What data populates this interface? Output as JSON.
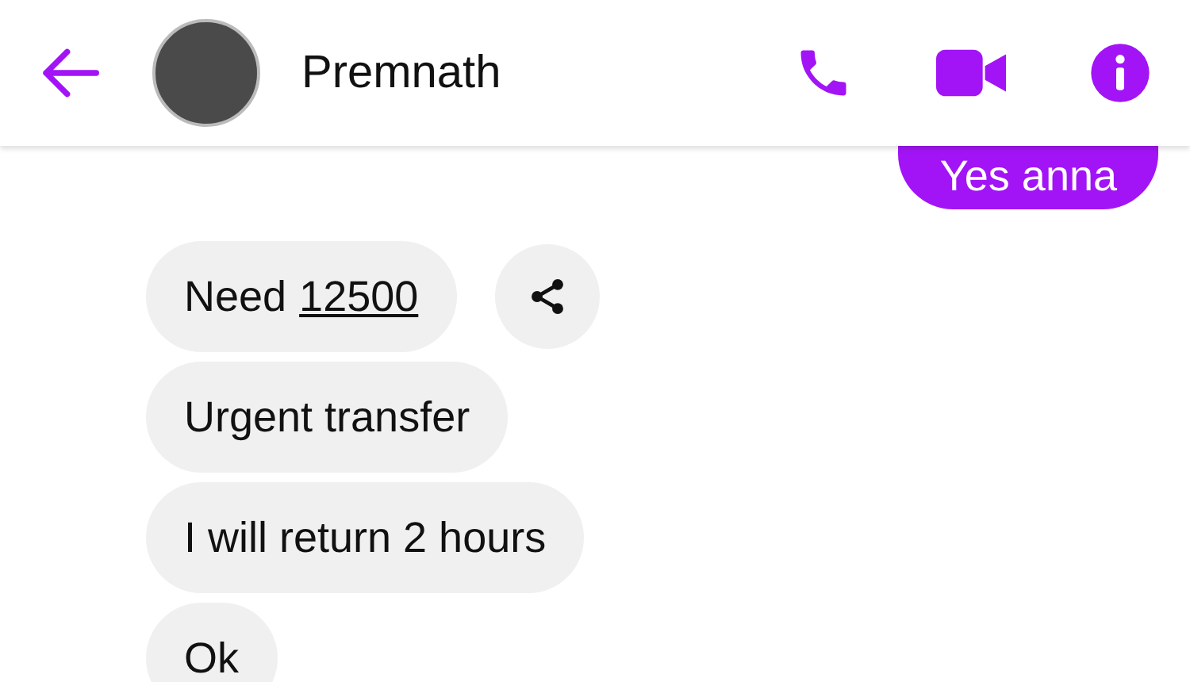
{
  "header": {
    "contact_name": "Premnath"
  },
  "messages": [
    {
      "kind": "sent",
      "text": "Yes anna"
    },
    {
      "kind": "received",
      "text": "Need",
      "link": "12500",
      "shareable": true
    },
    {
      "kind": "received",
      "text": "Urgent transfer"
    },
    {
      "kind": "received",
      "text": "I will return 2 hours"
    },
    {
      "kind": "received",
      "text": "Ok"
    }
  ]
}
